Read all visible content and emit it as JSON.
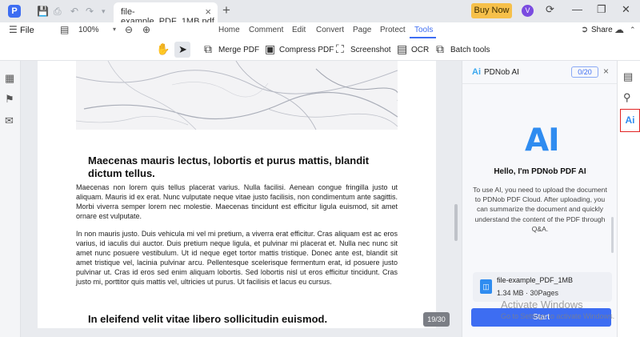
{
  "titlebar": {
    "tab_title": "file-example_PDF_1MB.pdf",
    "tab_close": "×",
    "new_tab": "+",
    "buy_now": "Buy Now",
    "avatar_initial": "V",
    "app_logo": "P"
  },
  "menubar": {
    "file": "File",
    "zoom_value": "100%",
    "tabs": [
      "Home",
      "Comment",
      "Edit",
      "Convert",
      "Page",
      "Protect",
      "Tools"
    ],
    "active_tab": "Tools",
    "share": "Share"
  },
  "toolbar": {
    "tools": [
      "Merge PDF",
      "Compress PDF",
      "Screenshot",
      "OCR",
      "Batch tools"
    ]
  },
  "document": {
    "heading1": "Maecenas mauris lectus, lobortis et purus mattis, blandit dictum tellus.",
    "para1": "Maecenas non lorem quis tellus placerat varius. Nulla facilisi. Aenean congue fringilla justo ut aliquam. Mauris id ex erat. Nunc vulputate neque vitae justo facilisis, non condimentum ante sagittis. Morbi viverra semper lorem nec molestie. Maecenas tincidunt est efficitur ligula euismod, sit amet ornare est vulputate.",
    "para2": "In non mauris justo. Duis vehicula mi vel mi pretium, a viverra erat efficitur. Cras aliquam est ac eros varius, id iaculis dui auctor. Duis pretium neque ligula, et pulvinar mi placerat et. Nulla nec nunc sit amet nunc posuere vestibulum. Ut id neque eget tortor mattis tristique. Donec ante est, blandit sit amet tristique vel, lacinia pulvinar arcu. Pellentesque scelerisque fermentum erat, id posuere justo pulvinar ut. Cras id eros sed enim aliquam lobortis. Sed lobortis nisl ut eros efficitur tincidunt. Cras justo mi, porttitor quis mattis vel, ultricies ut purus. Ut facilisis et lacus eu cursus.",
    "heading2": "In eleifend velit vitae libero sollicitudin euismod.",
    "page_counter": "19/30"
  },
  "ai_panel": {
    "logo": "Ai",
    "title": "PDNob AI",
    "counter": "0/20",
    "close": "×",
    "big_logo": "AI",
    "greeting": "Hello, I'm PDNob PDF AI",
    "description": "To use AI, you need to upload the document to PDNob PDF Cloud. After uploading, you can summarize the document and quickly understand the content of the PDF through Q&A.",
    "file_name": "file-example_PDF_1MB",
    "file_meta": "1.34 MB · 30Pages",
    "start": "Start",
    "watermark_line1": "Activate Windows",
    "watermark_line2": "Go to Settings to activate Windows."
  },
  "rightbar": {
    "ai_label": "Ai"
  },
  "icons": {
    "save": "save-icon",
    "print": "print-icon",
    "undo": "undo-icon",
    "redo": "redo-icon",
    "hand": "hand-icon",
    "pointer": "pointer-icon"
  },
  "colors": {
    "accent": "#3d6df2",
    "buy_now": "#f6c04a",
    "ai_blue": "#2f8cf0",
    "highlight_border": "#e02424"
  }
}
